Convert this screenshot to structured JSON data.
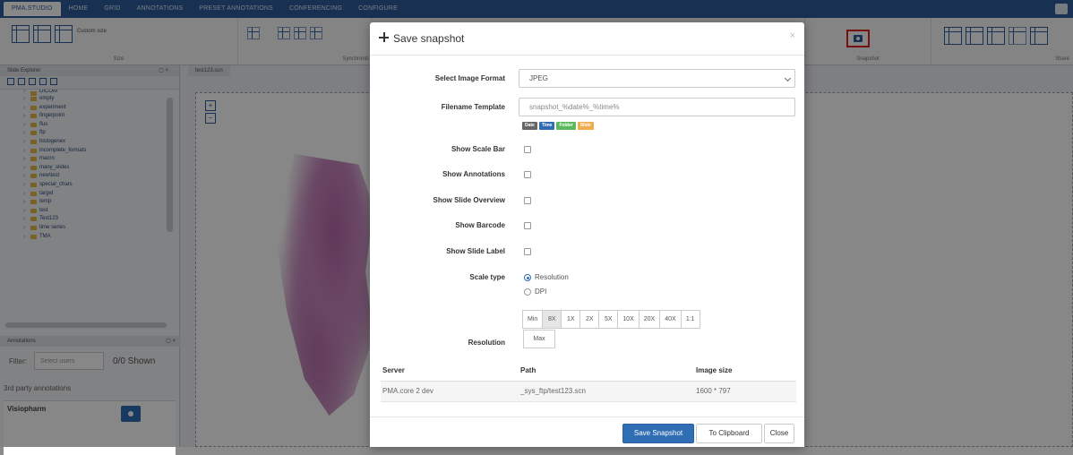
{
  "menu": {
    "tabs": [
      "PMA.STUDIO",
      "HOME",
      "GRID",
      "ANNOTATIONS",
      "PRESET ANNOTATIONS",
      "CONFERENCING",
      "CONFIGURE"
    ],
    "active_index": 0
  },
  "ribbon": {
    "groups": [
      {
        "label": "Size",
        "custom_size": "Custom size"
      },
      {
        "label": "Synchroniz"
      },
      {
        "label": "Snapshot"
      },
      {
        "label": "Share"
      }
    ]
  },
  "slide_explorer": {
    "title": "Slide Explorer",
    "items": [
      "DICOM",
      "empty",
      "experiment",
      "fingerpoint",
      "flus",
      "ftp",
      "histogenex",
      "incomplete_formats",
      "macro",
      "many_slides",
      "new\\test",
      "special_chars",
      "target",
      "temp",
      "test",
      "Test123",
      "time series",
      "TMA"
    ]
  },
  "annotations_panel": {
    "title": "Annotations",
    "filter_label": "Filter:",
    "filter_placeholder": "Select users",
    "shown": "0/0 Shown",
    "third_party": "3rd party annotations",
    "vendor": "Visiopharm"
  },
  "viewer": {
    "tab_title": "test123.scn"
  },
  "modal": {
    "title": "Save snapshot",
    "fields": {
      "format_label": "Select Image Format",
      "format_value": "JPEG",
      "filename_label": "Filename Template",
      "filename_value": "snapshot_%date%_%time%",
      "tags": [
        {
          "text": "Date",
          "color": "#666666"
        },
        {
          "text": "Time",
          "color": "#2f6db5"
        },
        {
          "text": "Folder",
          "color": "#5cb85c"
        },
        {
          "text": "Slide",
          "color": "#f0ad4e"
        }
      ],
      "scale_bar": "Show Scale Bar",
      "annotations": "Show Annotations",
      "overview": "Show Slide Overview",
      "barcode": "Show Barcode",
      "slide_label": "Show Slide Label",
      "scale_type_label": "Scale type",
      "scale_types": [
        "Resolution",
        "DPI"
      ],
      "resolution_label": "Resolution",
      "resolutions": [
        "Min",
        "8X",
        "1X",
        "2X",
        "5X",
        "10X",
        "20X",
        "40X",
        "1:1"
      ],
      "resolution_max": "Max"
    },
    "table": {
      "headers": [
        "Server",
        "Path",
        "Image size"
      ],
      "row": [
        "PMA.core 2 dev",
        "_sys_ftp/test123.scn",
        "1600 * 797"
      ]
    },
    "buttons": {
      "save": "Save Snapshot",
      "clipboard": "To Clipboard",
      "close": "Close"
    }
  },
  "colors": {
    "primary": "#2f6db5",
    "menubar": "#2f5d9e",
    "highlight": "#e02020"
  }
}
